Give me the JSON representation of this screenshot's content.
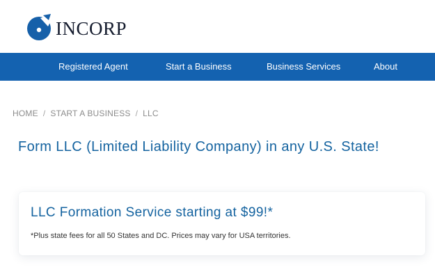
{
  "brand": {
    "name": "INCORP",
    "colors": {
      "primary_blue": "#1462b0",
      "title_blue": "#13629f",
      "logo_dark": "#141b2d"
    }
  },
  "nav": {
    "items": [
      {
        "label": "Registered Agent"
      },
      {
        "label": "Start a Business"
      },
      {
        "label": "Business Services"
      },
      {
        "label": "About"
      }
    ]
  },
  "breadcrumb": {
    "items": [
      {
        "label": "HOME"
      },
      {
        "label": "START A BUSINESS"
      },
      {
        "label": "LLC"
      }
    ],
    "separator": "/"
  },
  "main": {
    "title": "Form LLC (Limited Liability Company) in any U.S. State!",
    "offer": {
      "heading": "LLC Formation Service starting at $99!*",
      "note": "*Plus state fees for all 50 States and DC. Prices may vary for USA territories."
    }
  },
  "icons": {
    "logo": "incorp-logo-icon"
  }
}
